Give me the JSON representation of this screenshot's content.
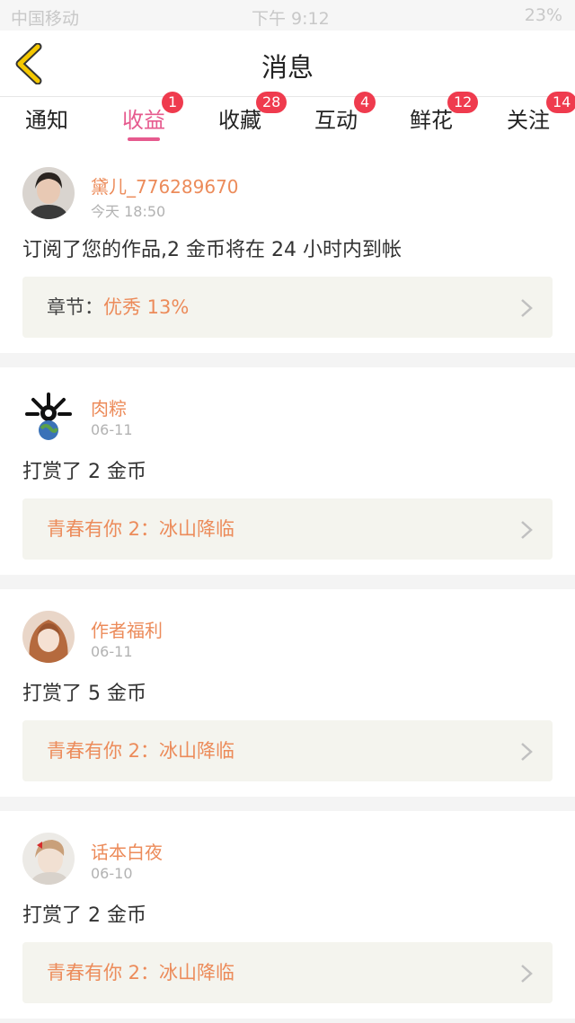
{
  "status_bar": {
    "carrier": "中国移动",
    "time": "下午 9:12",
    "battery": "23%"
  },
  "nav": {
    "title": "消息"
  },
  "tabs": [
    {
      "label": "通知",
      "badge": ""
    },
    {
      "label": "收益",
      "badge": "1",
      "active": true
    },
    {
      "label": "收藏",
      "badge": "28"
    },
    {
      "label": "互动",
      "badge": "4"
    },
    {
      "label": "鲜花",
      "badge": "12"
    },
    {
      "label": "关注",
      "badge": "14"
    }
  ],
  "messages": [
    {
      "user": "黛儿_776289670",
      "time": "今天 18:50",
      "text": "订阅了您的作品,2 金币将在 24 小时内到帐",
      "ref_prefix": "章节：",
      "ref_title": "优秀 13%"
    },
    {
      "user": "肉粽",
      "time": "06-11",
      "text": "打赏了 2 金币",
      "ref_prefix": "",
      "ref_title": "青春有你 2：冰山降临"
    },
    {
      "user": "作者福利",
      "time": "06-11",
      "text": "打赏了 5 金币",
      "ref_prefix": "",
      "ref_title": "青春有你 2：冰山降临"
    },
    {
      "user": "话本白夜",
      "time": "06-10",
      "text": "打赏了 2 金币",
      "ref_prefix": "",
      "ref_title": "青春有你 2：冰山降临"
    }
  ],
  "colors": {
    "accent": "#e65a8e",
    "badge": "#ef3b4e",
    "username": "#ec8b5a",
    "ref_bg": "#f4f4ee"
  }
}
